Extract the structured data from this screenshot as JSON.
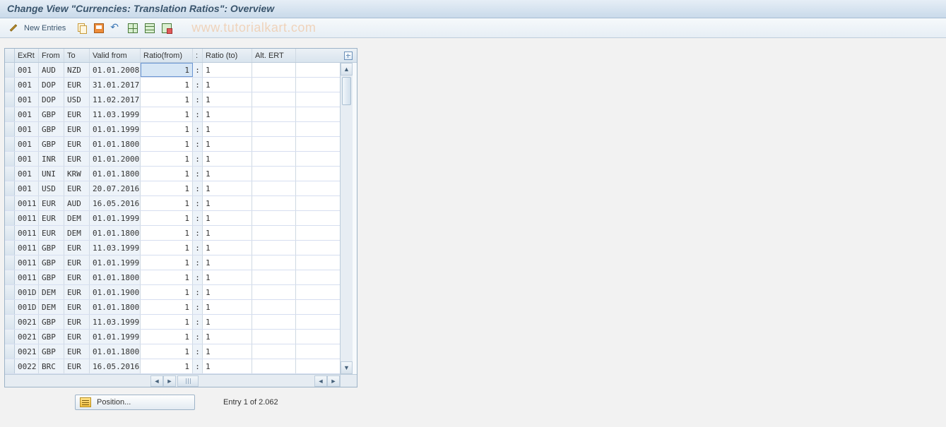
{
  "title": "Change View \"Currencies: Translation Ratios\": Overview",
  "toolbar": {
    "new_entries": "New Entries"
  },
  "watermark": "www.tutorialkart.com",
  "columns": {
    "exrt": "ExRt",
    "from": "From",
    "to": "To",
    "valid": "Valid from",
    "rfrom": "Ratio(from)",
    "colon": ":",
    "rto": "Ratio (to)",
    "alt": "Alt. ERT"
  },
  "rows": [
    {
      "exrt": "001",
      "from": "AUD",
      "to": "NZD",
      "valid": "01.01.2008",
      "rfrom": "1",
      "rto": "1",
      "alt": "",
      "sel": true
    },
    {
      "exrt": "001",
      "from": "DOP",
      "to": "EUR",
      "valid": "31.01.2017",
      "rfrom": "1",
      "rto": "1",
      "alt": ""
    },
    {
      "exrt": "001",
      "from": "DOP",
      "to": "USD",
      "valid": "11.02.2017",
      "rfrom": "1",
      "rto": "1",
      "alt": ""
    },
    {
      "exrt": "001",
      "from": "GBP",
      "to": "EUR",
      "valid": "11.03.1999",
      "rfrom": "1",
      "rto": "1",
      "alt": ""
    },
    {
      "exrt": "001",
      "from": "GBP",
      "to": "EUR",
      "valid": "01.01.1999",
      "rfrom": "1",
      "rto": "1",
      "alt": ""
    },
    {
      "exrt": "001",
      "from": "GBP",
      "to": "EUR",
      "valid": "01.01.1800",
      "rfrom": "1",
      "rto": "1",
      "alt": ""
    },
    {
      "exrt": "001",
      "from": "INR",
      "to": "EUR",
      "valid": "01.01.2000",
      "rfrom": "1",
      "rto": "1",
      "alt": ""
    },
    {
      "exrt": "001",
      "from": "UNI",
      "to": "KRW",
      "valid": "01.01.1800",
      "rfrom": "1",
      "rto": "1",
      "alt": ""
    },
    {
      "exrt": "001",
      "from": "USD",
      "to": "EUR",
      "valid": "20.07.2016",
      "rfrom": "1",
      "rto": "1",
      "alt": ""
    },
    {
      "exrt": "0011",
      "from": "EUR",
      "to": "AUD",
      "valid": "16.05.2016",
      "rfrom": "1",
      "rto": "1",
      "alt": ""
    },
    {
      "exrt": "0011",
      "from": "EUR",
      "to": "DEM",
      "valid": "01.01.1999",
      "rfrom": "1",
      "rto": "1",
      "alt": ""
    },
    {
      "exrt": "0011",
      "from": "EUR",
      "to": "DEM",
      "valid": "01.01.1800",
      "rfrom": "1",
      "rto": "1",
      "alt": ""
    },
    {
      "exrt": "0011",
      "from": "GBP",
      "to": "EUR",
      "valid": "11.03.1999",
      "rfrom": "1",
      "rto": "1",
      "alt": ""
    },
    {
      "exrt": "0011",
      "from": "GBP",
      "to": "EUR",
      "valid": "01.01.1999",
      "rfrom": "1",
      "rto": "1",
      "alt": ""
    },
    {
      "exrt": "0011",
      "from": "GBP",
      "to": "EUR",
      "valid": "01.01.1800",
      "rfrom": "1",
      "rto": "1",
      "alt": ""
    },
    {
      "exrt": "001D",
      "from": "DEM",
      "to": "EUR",
      "valid": "01.01.1900",
      "rfrom": "1",
      "rto": "1",
      "alt": ""
    },
    {
      "exrt": "001D",
      "from": "DEM",
      "to": "EUR",
      "valid": "01.01.1800",
      "rfrom": "1",
      "rto": "1",
      "alt": ""
    },
    {
      "exrt": "0021",
      "from": "GBP",
      "to": "EUR",
      "valid": "11.03.1999",
      "rfrom": "1",
      "rto": "1",
      "alt": ""
    },
    {
      "exrt": "0021",
      "from": "GBP",
      "to": "EUR",
      "valid": "01.01.1999",
      "rfrom": "1",
      "rto": "1",
      "alt": ""
    },
    {
      "exrt": "0021",
      "from": "GBP",
      "to": "EUR",
      "valid": "01.01.1800",
      "rfrom": "1",
      "rto": "1",
      "alt": ""
    },
    {
      "exrt": "0022",
      "from": "BRC",
      "to": "EUR",
      "valid": "16.05.2016",
      "rfrom": "1",
      "rto": "1",
      "alt": ""
    }
  ],
  "footer": {
    "position_label": "Position...",
    "entry_text": "Entry 1 of 2.062"
  }
}
